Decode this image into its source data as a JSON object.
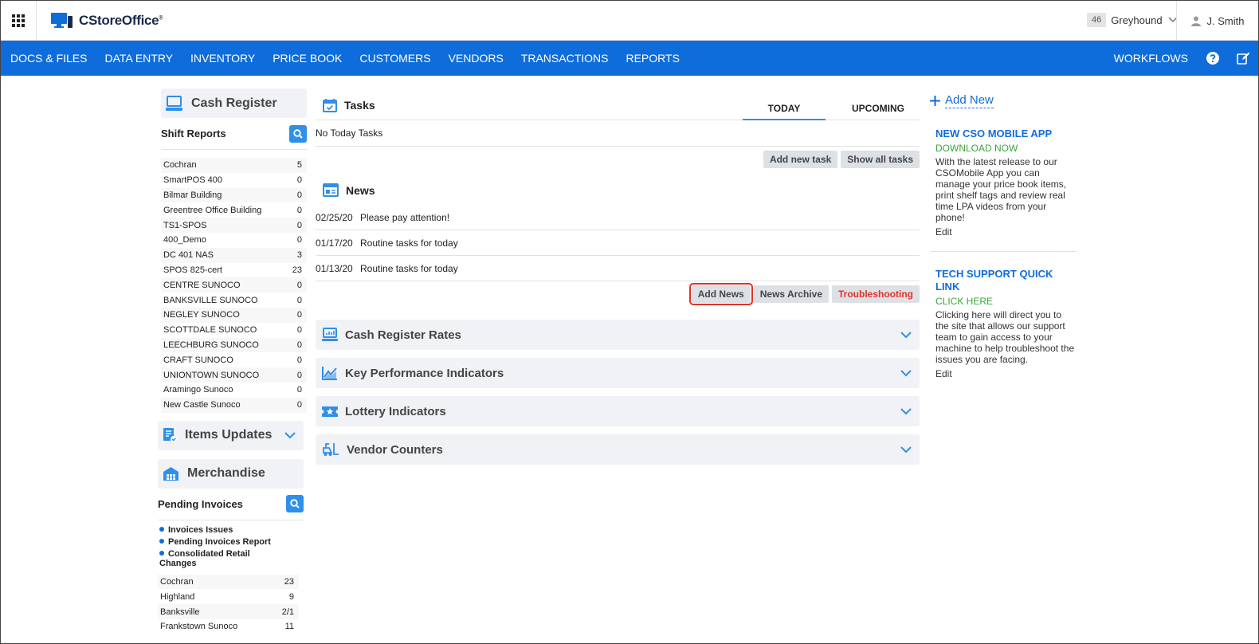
{
  "header": {
    "logo_text": "CStoreOffice",
    "logo_mark": "®",
    "store_count": "46",
    "store_name": "Greyhound",
    "user_name": "J. Smith"
  },
  "nav": {
    "items": [
      "DOCS & FILES",
      "DATA ENTRY",
      "INVENTORY",
      "PRICE BOOK",
      "CUSTOMERS",
      "VENDORS",
      "TRANSACTIONS",
      "REPORTS"
    ],
    "workflows": "WORKFLOWS"
  },
  "left": {
    "cash_register_title": "Cash Register",
    "shift_reports_label": "Shift Reports",
    "shift_reports": [
      {
        "name": "Cochran",
        "count": "5"
      },
      {
        "name": "SmartPOS 400",
        "count": "0"
      },
      {
        "name": "Bilmar Building",
        "count": "0"
      },
      {
        "name": "Greentree Office Building",
        "count": "0"
      },
      {
        "name": "TS1-SPOS",
        "count": "0"
      },
      {
        "name": "400_Demo",
        "count": "0"
      },
      {
        "name": "DC 401 NAS",
        "count": "3"
      },
      {
        "name": "SPOS 825-cert",
        "count": "23"
      },
      {
        "name": "CENTRE SUNOCO",
        "count": "0"
      },
      {
        "name": "BANKSVILLE SUNOCO",
        "count": "0"
      },
      {
        "name": "NEGLEY SUNOCO",
        "count": "0"
      },
      {
        "name": "SCOTTDALE SUNOCO",
        "count": "0"
      },
      {
        "name": "LEECHBURG SUNOCO",
        "count": "0"
      },
      {
        "name": "CRAFT SUNOCO",
        "count": "0"
      },
      {
        "name": "UNIONTOWN SUNOCO",
        "count": "0"
      },
      {
        "name": "Aramingo Sunoco",
        "count": "0"
      },
      {
        "name": "New Castle Sunoco",
        "count": "0"
      }
    ],
    "items_updates_title": "Items Updates",
    "merchandise_title": "Merchandise",
    "pending_invoices_label": "Pending Invoices",
    "invoice_links": [
      "Invoices Issues",
      "Pending Invoices Report",
      "Consolidated Retail Changes"
    ],
    "pending_invoices": [
      {
        "name": "Cochran",
        "count": "23"
      },
      {
        "name": "Highland",
        "count": "9"
      },
      {
        "name": "Banksville",
        "count": "2/1"
      },
      {
        "name": "Frankstown Sunoco",
        "count": "11"
      }
    ]
  },
  "tasks": {
    "title": "Tasks",
    "tab_today": "TODAY",
    "tab_upcoming": "UPCOMING",
    "empty_text": "No Today Tasks",
    "add_btn": "Add new task",
    "show_btn": "Show all tasks"
  },
  "news": {
    "title": "News",
    "items": [
      {
        "date": "02/25/20",
        "text": "Please pay attention!"
      },
      {
        "date": "01/17/20",
        "text": "Routine tasks for today"
      },
      {
        "date": "01/13/20",
        "text": "Routine tasks for today"
      }
    ],
    "add_btn": "Add News",
    "archive_btn": "News Archive",
    "trouble_btn": "Troubleshooting"
  },
  "accordions": [
    "Cash Register Rates",
    "Key Performance Indicators",
    "Lottery Indicators",
    "Vendor Counters"
  ],
  "right": {
    "add_new": "Add New",
    "card1": {
      "title": "NEW CSO MOBILE APP",
      "link": "DOWNLOAD NOW",
      "body": "With the latest release to our CSOMobile App you can manage your price book items, print shelf tags and review real time LPA videos from your phone!",
      "edit": "Edit"
    },
    "card2": {
      "title": "TECH SUPPORT QUICK LINK",
      "link": "CLICK HERE",
      "body": "Clicking here will direct you to the site that allows our support team to gain access to your machine to help troubleshoot the issues you are facing.",
      "edit": "Edit"
    }
  },
  "colors": {
    "nav_blue": "#0f6ddb",
    "accent_blue": "#2f8fea",
    "green": "#3aa637",
    "red": "#e0322a"
  }
}
